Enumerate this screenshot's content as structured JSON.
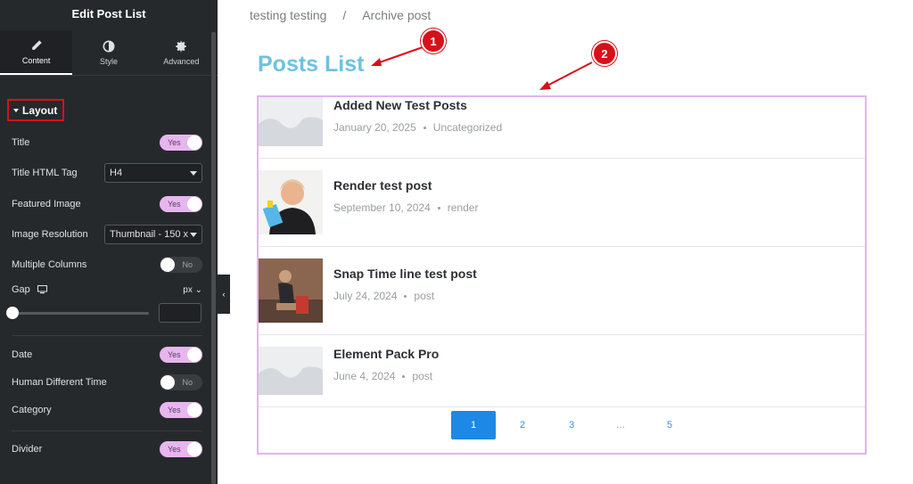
{
  "panel": {
    "title": "Edit Post List",
    "tabs": [
      {
        "label": "Content",
        "icon": "pencil-icon"
      },
      {
        "label": "Style",
        "icon": "contrast-icon"
      },
      {
        "label": "Advanced",
        "icon": "gear-icon"
      }
    ],
    "section": "Layout",
    "controls": {
      "title": {
        "label": "Title",
        "state": "Yes"
      },
      "title_tag": {
        "label": "Title HTML Tag",
        "value": "H4"
      },
      "featured_image": {
        "label": "Featured Image",
        "state": "Yes"
      },
      "image_resolution": {
        "label": "Image Resolution",
        "value": "Thumbnail - 150 x"
      },
      "multiple_columns": {
        "label": "Multiple Columns",
        "state": "No"
      },
      "gap": {
        "label": "Gap",
        "unit": "px"
      },
      "date": {
        "label": "Date",
        "state": "Yes"
      },
      "human_time": {
        "label": "Human Different Time",
        "state": "No"
      },
      "category": {
        "label": "Category",
        "state": "Yes"
      },
      "divider": {
        "label": "Divider",
        "state": "Yes"
      }
    }
  },
  "breadcrumb": {
    "parent": "testing testing",
    "separator": "/",
    "current": "Archive post"
  },
  "heading": "Posts List",
  "markers": [
    "1",
    "2"
  ],
  "posts": [
    {
      "title": "Added New Test Posts",
      "date": "January 20, 2025",
      "category": "Uncategorized",
      "image": "placeholder"
    },
    {
      "title": "Render test post",
      "date": "September 10, 2024",
      "category": "render",
      "image": "woman-photo"
    },
    {
      "title": "Snap Time line test post",
      "date": "July 24, 2024",
      "category": "post",
      "image": "gym-photo"
    },
    {
      "title": "Element Pack Pro",
      "date": "June 4, 2024",
      "category": "post",
      "image": "placeholder"
    }
  ],
  "pagination": [
    "1",
    "2",
    "3",
    "…",
    "5"
  ],
  "colors": {
    "heading": "#6ec1e4",
    "toggle_on": "#e7b6ee",
    "active_page": "#1e88e5",
    "marker": "#d6111a",
    "list_border": "#e3b3ef"
  }
}
